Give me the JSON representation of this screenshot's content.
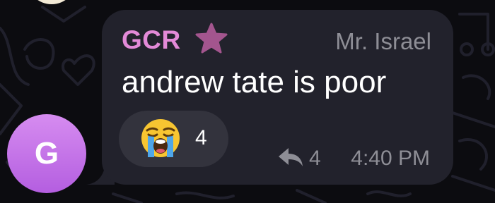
{
  "message": {
    "sender_name": "GCR",
    "sender_color": "#e38ad8",
    "sender_badge_icon": "star-icon",
    "sender_role": "Mr. Israel",
    "text": "andrew tate is poor",
    "avatar_letter": "G",
    "avatar_color": "#c474e8",
    "reaction": {
      "emoji_icon": "loudly-crying-face-icon",
      "count": "4"
    },
    "reply": {
      "icon": "reply-icon",
      "count": "4"
    },
    "time": "4:40 PM"
  }
}
